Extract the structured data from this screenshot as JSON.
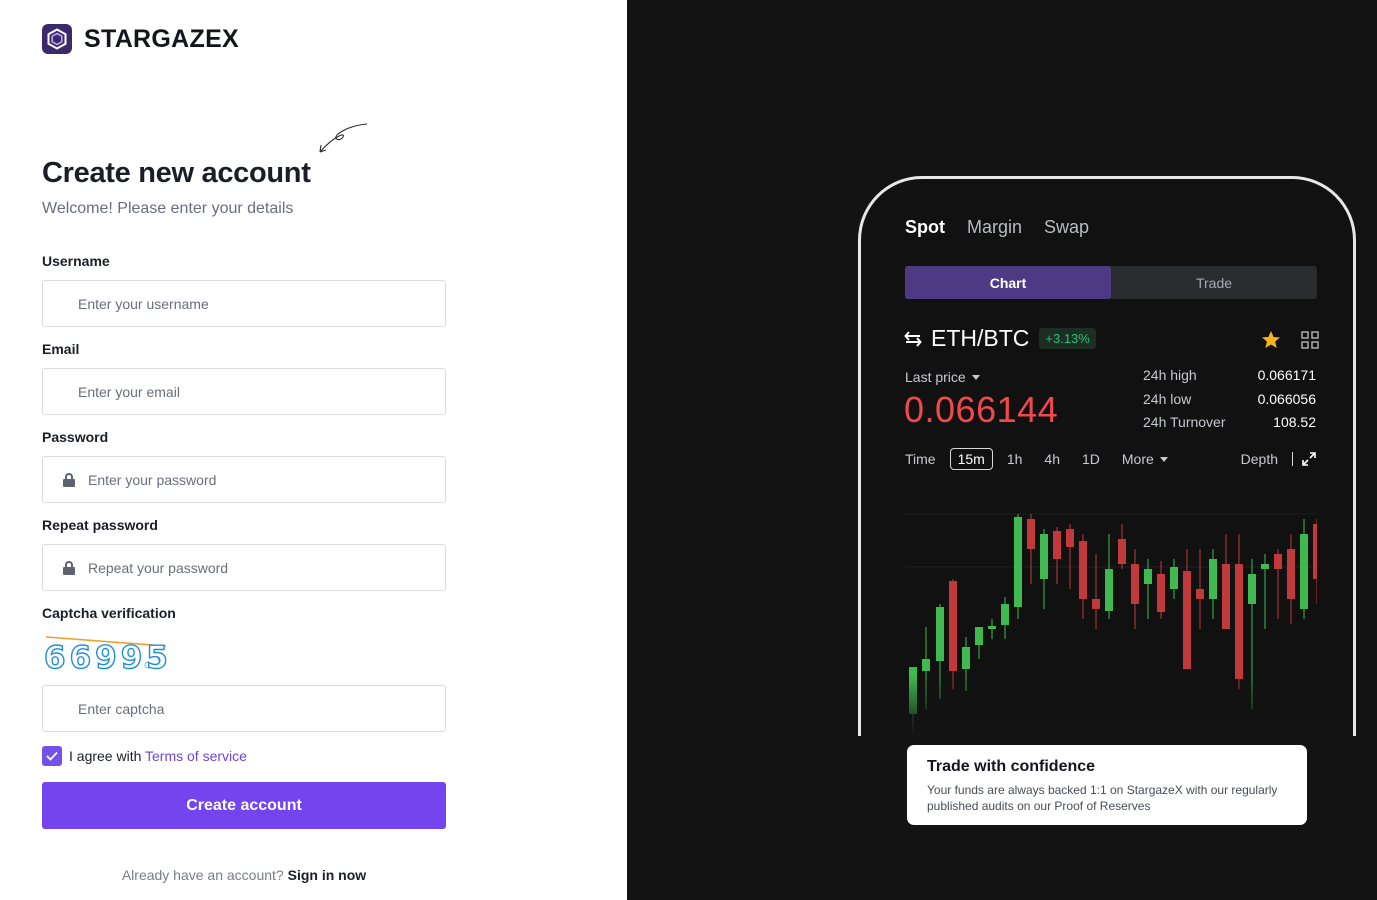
{
  "brand": {
    "name": "STARGAZEX",
    "logo_icon": "hexagon-logo-icon",
    "logo_color": "#3a2a6b"
  },
  "form": {
    "title": "Create new account",
    "subtitle": "Welcome! Please enter your details",
    "username": {
      "label": "Username",
      "placeholder": "Enter your username",
      "value": ""
    },
    "email": {
      "label": "Email",
      "placeholder": "Enter your email",
      "value": ""
    },
    "password": {
      "label": "Password",
      "placeholder": "Enter your password",
      "value": "",
      "icon": "lock-icon"
    },
    "repeat_password": {
      "label": "Repeat password",
      "placeholder": "Repeat your password",
      "value": "",
      "icon": "lock-icon"
    },
    "captcha": {
      "label": "Captcha verification",
      "code": "66995",
      "placeholder": "Enter captcha",
      "value": ""
    },
    "agree": {
      "checked": true,
      "text": "I agree with ",
      "link": "Terms of service"
    },
    "submit_label": "Create account",
    "signin_prompt": "Already have an account? ",
    "signin_link": "Sign in now",
    "accent_color": "#7444ee"
  },
  "promo": {
    "top_tabs": [
      {
        "label": "Spot",
        "active": true
      },
      {
        "label": "Margin",
        "active": false
      },
      {
        "label": "Swap",
        "active": false
      }
    ],
    "segments": [
      {
        "label": "Chart",
        "active": true
      },
      {
        "label": "Trade",
        "active": false
      }
    ],
    "pair": "ETH/BTC",
    "change_pct": "+3.13%",
    "last_price_label": "Last price",
    "last_price": "0.066144",
    "stats": [
      {
        "label": "24h high",
        "value": "0.066171"
      },
      {
        "label": "24h low",
        "value": "0.066056"
      },
      {
        "label": "24h Turnover",
        "value": "108.52"
      }
    ],
    "intervals": [
      "Time",
      "15m",
      "1h",
      "4h",
      "1D"
    ],
    "active_interval": "15m",
    "more_label": "More",
    "depth_label": "Depth",
    "up_color": "#3fb950",
    "down_color": "#c0393b",
    "card": {
      "title": "Trade with confidence",
      "body": "Your funds are always backed 1:1 on StargazeX with our regularly published audits on our Proof of Reserves"
    }
  }
}
